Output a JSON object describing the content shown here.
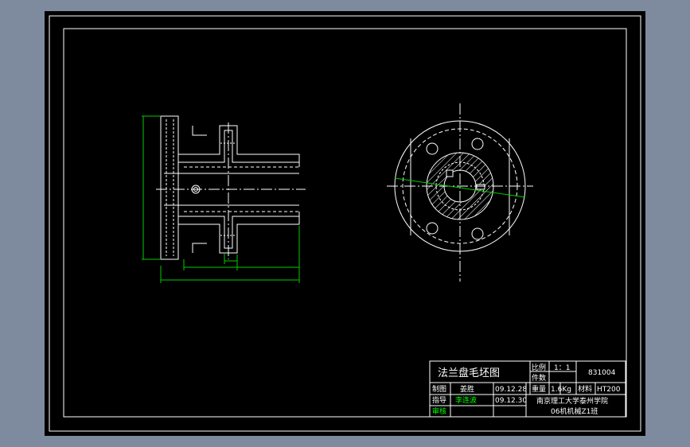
{
  "drawing": {
    "title": "法兰盘毛坯图",
    "colors": {
      "background": "#000000",
      "viewport": "#7e8a9d",
      "line": "#ffffff",
      "dimension": "#00cc00",
      "hatch": "#ffffff",
      "section_line": "#00cc00",
      "label_green": "#00ff00"
    }
  },
  "title_block": {
    "scale_label": "比例",
    "scale_value": "1：1",
    "count_label": "件数",
    "drawing_number": "831004",
    "weight_label": "重量",
    "weight_value": "1.6Kg",
    "material_label": "材料",
    "material_value": "HT200",
    "drawn_label": "制图",
    "drawn_name": "姜胜",
    "drawn_date": "09.12.28",
    "guide_label": "指导",
    "guide_name": "李连波",
    "guide_date": "09.12.30",
    "review_label": "审核",
    "school": "南京理工大学泰州学院",
    "class": "06机机械Z1班"
  }
}
